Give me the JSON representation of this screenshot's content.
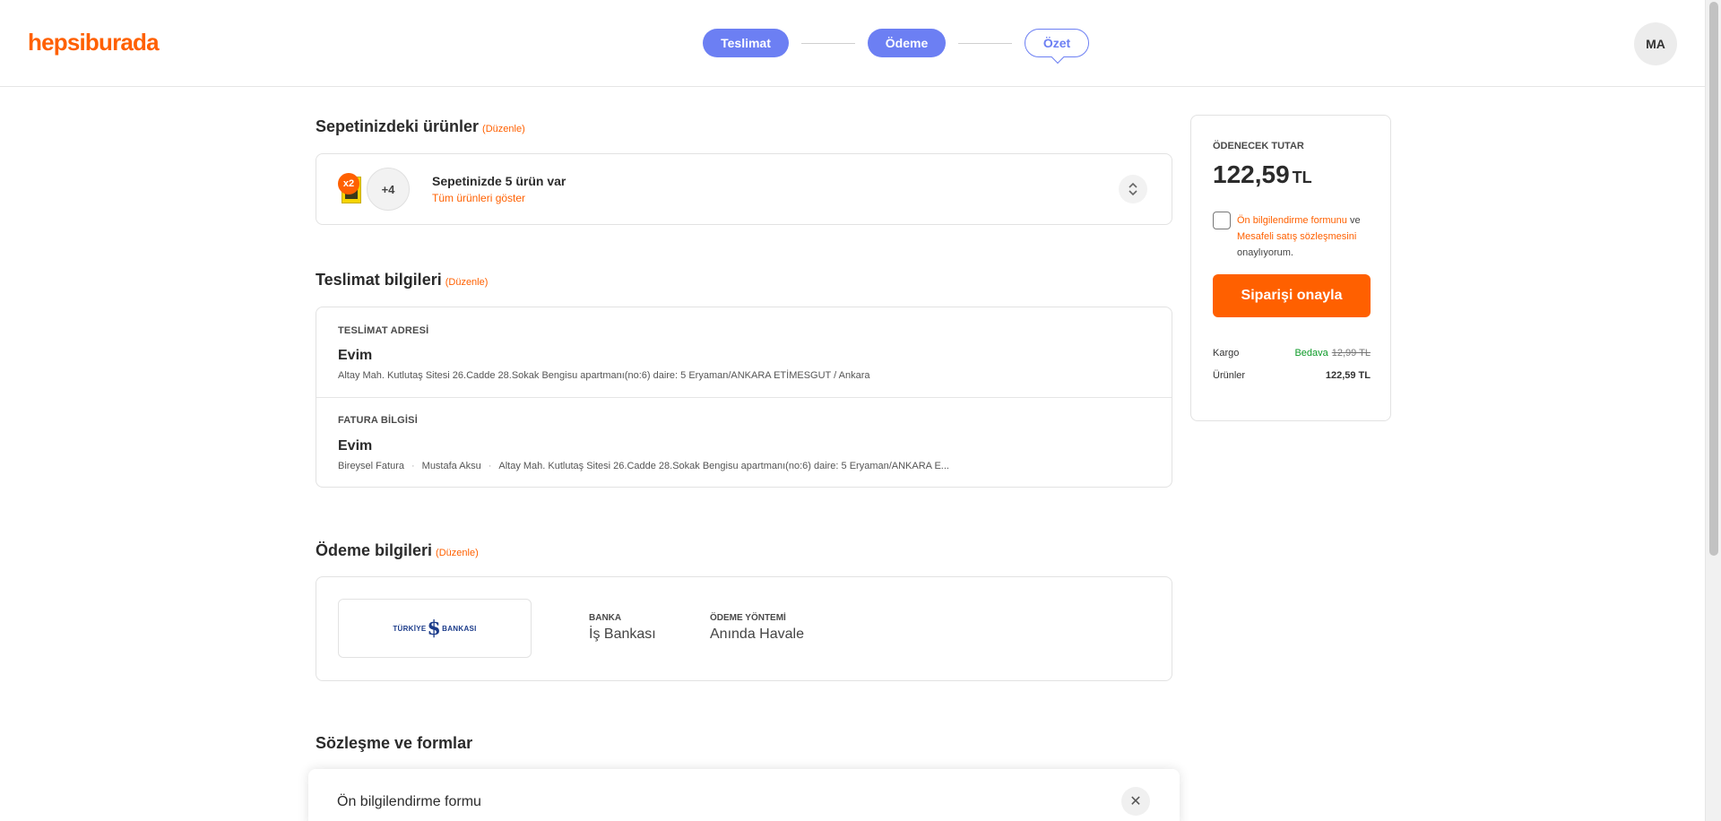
{
  "header": {
    "logo": "hepsiburada",
    "steps": [
      {
        "label": "Teslimat",
        "state": "done"
      },
      {
        "label": "Ödeme",
        "state": "done"
      },
      {
        "label": "Özet",
        "state": "current"
      }
    ],
    "avatar_initials": "MA"
  },
  "cart": {
    "title": "Sepetinizdeki ürünler",
    "edit": "(Düzenle)",
    "qty_badge": "x2",
    "more_count": "+4",
    "count_text": "Sepetinizde 5 ürün var",
    "show_all": "Tüm ürünleri göster"
  },
  "delivery": {
    "title": "Teslimat bilgileri",
    "edit": "(Düzenle)",
    "address_heading": "TESLİMAT ADRESİ",
    "address_name": "Evim",
    "address_line": "Altay Mah. Kutlutaş Sitesi 26.Cadde 28.Sokak Bengisu apartmanı(no:6) daire: 5 Eryaman/ANKARA ETİMESGUT / Ankara",
    "invoice_heading": "FATURA BİLGİSİ",
    "invoice_name": "Evim",
    "invoice_type": "Bireysel Fatura",
    "invoice_person": "Mustafa Aksu",
    "invoice_address": "Altay Mah. Kutlutaş Sitesi 26.Cadde 28.Sokak Bengisu apartmanı(no:6) daire: 5 Eryaman/ANKARA E..."
  },
  "payment": {
    "title": "Ödeme bilgileri",
    "edit": "(Düzenle)",
    "bank_logo_left": "TÜRKİYE",
    "bank_logo_mark": "$",
    "bank_logo_right": "BANKASI",
    "bank_label": "BANKA",
    "bank_value": "İş Bankası",
    "method_label": "ÖDEME YÖNTEMİ",
    "method_value": "Anında Havale"
  },
  "contracts": {
    "title": "Sözleşme ve formlar",
    "popup_title": "Ön bilgilendirme formu",
    "close_glyph": "✕"
  },
  "summary": {
    "label": "ÖDENECEK TUTAR",
    "amount": "122,59",
    "currency": "TL",
    "agree_link1": "Ön bilgilendirme formunu",
    "agree_and": " ve ",
    "agree_link2": "Mesafeli satış sözleşmesini",
    "agree_tail": " onaylıyorum.",
    "confirm_button": "Siparişi onayla",
    "shipping_label": "Kargo",
    "shipping_free": "Bedava",
    "shipping_old": "12,99 TL",
    "products_label": "Ürünler",
    "products_value": "122,59 TL"
  },
  "colors": {
    "brand": "#ff6000",
    "step_accent": "#6c7ff3",
    "free_green": "#0c9a27"
  },
  "icons": {
    "expand": "chevron-up-down-icon",
    "close": "close-icon"
  }
}
